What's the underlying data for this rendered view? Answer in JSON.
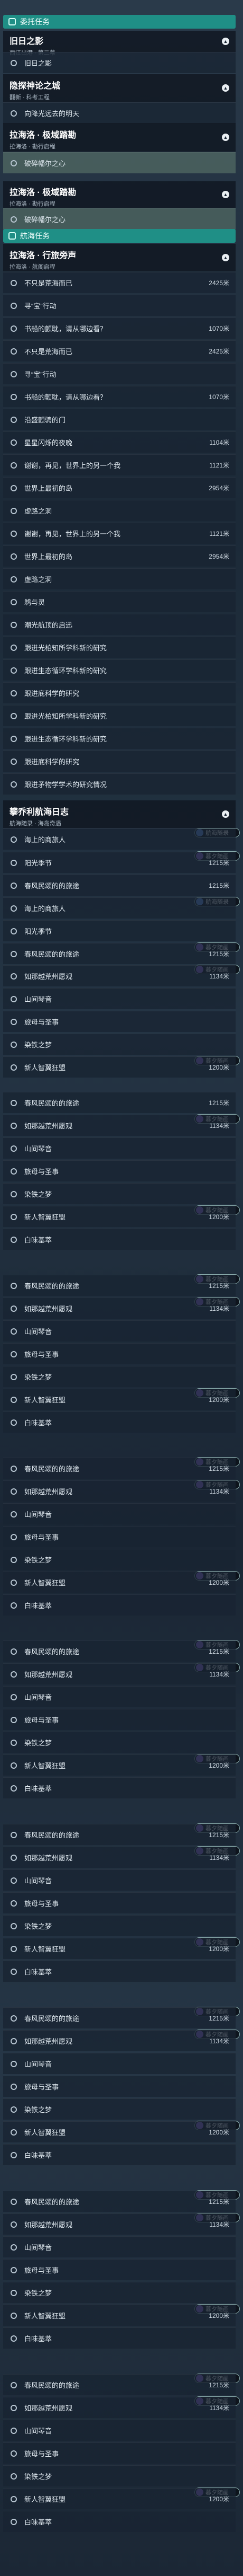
{
  "section_headers": {
    "daily": "委托任务",
    "voyage": "航海任务"
  },
  "groups": [
    {
      "title": "旧日之影",
      "sub": "西江出港 · 第二幕"
    },
    {
      "title": "隐探神论之城",
      "sub": "翻新 · 科考工程"
    },
    {
      "title": "拉海洛 · 极域踏勘",
      "sub": "拉海洛 · 勘行启程"
    },
    {
      "title": "拉海洛 · 极域踏勘",
      "sub": "拉海洛 · 勘行启程"
    },
    {
      "title": "拉海洛 · 行旅旁声",
      "sub": "拉海洛 · 航阁启程"
    },
    {
      "title": "攀乔利航海日志",
      "sub": "航海随录 · 海岛奇遇"
    }
  ],
  "items": {
    "a1": "旧日之影",
    "a2": "向降光远去的明天",
    "a3": "破碎幡尔之心",
    "a4": "破碎幡尔之心",
    "b1": "不只是荒海而已",
    "b2": "寻“宝”行动",
    "b3": "书船的颤耽，请从哪边看？",
    "b4": "不只是荒海而已",
    "b5": "寻“宝”行动",
    "b6": "书船的颤耽，请从哪边看？",
    "b7": "沿盛颤骋的门",
    "b8": "星星闪烁的夜晚",
    "b9": "谢谢，再见，世界上的另一个我",
    "b10": "世界上最初的岛",
    "b11": "虚路之洞",
    "b12": "谢谢，再见，世界上的另一个我",
    "b13": "世界上最初的岛",
    "b14": "虚路之洞",
    "b15": "鹈与灵",
    "b16": "潮光航顶的启迅",
    "b17": "跟进光柏知所学科新的研究",
    "b18": "跟进生态循环学科新的研究",
    "b19": "跟进底科学的研究",
    "b20": "跟进光柏知所学科新的研究",
    "b21": "跟进生态循环学科新的研究",
    "b22": "跟进底科学的研究",
    "b23": "跟进矛物学学术的研究情况",
    "c1": "海上的商旅人",
    "c2": "阳光季节",
    "c3": "春风民颂的的旅途",
    "c4": "海上的商旅人",
    "c5": "阳光季节",
    "c6": "春风民颂的的旅途",
    "c7": "如那越荒州愿观",
    "c8": "山间琴音",
    "c9": "旅母与圣事",
    "c10": "染铁之梦",
    "c11": "新人智翼狂盟",
    "c12": "春风民颂的的旅途",
    "c13": "如那越荒州愿观",
    "c14": "山间琴音",
    "c15": "旅母与圣事",
    "c16": "染铁之梦",
    "c17": "新人智翼狂盟",
    "c18": "白味基萃",
    "c19": "春风民颂的的旅途",
    "c20": "如那越荒州愿观",
    "c21": "山间琴音",
    "c22": "旅母与圣事",
    "c23": "染铁之梦",
    "c24": "新人智翼狂盟",
    "c25": "白味基萃",
    "c26": "春风民颂的的旅途",
    "c27": "如那越荒州愿观",
    "c28": "山间琴音",
    "c29": "旅母与圣事",
    "c30": "染铁之梦",
    "c31": "新人智翼狂盟",
    "c32": "白味基萃"
  },
  "distances": {
    "d2425": "2425米",
    "d1070": "1070米",
    "d1104": "1104米",
    "d1121": "1121米",
    "d2954": "2954米",
    "d1215": "1215米",
    "d1134": "1134米",
    "d1200": "1200米"
  },
  "badges": {
    "voyage": "航海随录",
    "twilight": "暮夕随画"
  },
  "colors": {
    "accent": "#1f8f86",
    "selected": "#6e8c78",
    "badge_purple": "#8a63d2",
    "badge_blue": "#5a8ad8"
  }
}
